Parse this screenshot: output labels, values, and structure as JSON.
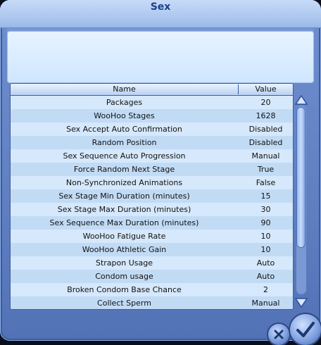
{
  "dialog": {
    "title": "Sex"
  },
  "table": {
    "columns": {
      "name": "Name",
      "value": "Value"
    },
    "rows": [
      {
        "name": "Packages",
        "value": "20"
      },
      {
        "name": "WooHoo Stages",
        "value": "1628"
      },
      {
        "name": "Sex Accept Auto Confirmation",
        "value": "Disabled"
      },
      {
        "name": "Random Position",
        "value": "Disabled"
      },
      {
        "name": "Sex Sequence Auto Progression",
        "value": "Manual"
      },
      {
        "name": "Force Random Next Stage",
        "value": "True"
      },
      {
        "name": "Non-Synchronized Animations",
        "value": "False"
      },
      {
        "name": "Sex Stage Min Duration (minutes)",
        "value": "15"
      },
      {
        "name": "Sex Stage Max Duration (minutes)",
        "value": "30"
      },
      {
        "name": "Sex Sequence Max Duration (minutes)",
        "value": "90"
      },
      {
        "name": "WooHoo Fatigue Rate",
        "value": "10"
      },
      {
        "name": "WooHoo Athletic Gain",
        "value": "10"
      },
      {
        "name": "Strapon Usage",
        "value": "Auto"
      },
      {
        "name": "Condom usage",
        "value": "Auto"
      },
      {
        "name": "Broken Condom Base Chance",
        "value": "2"
      },
      {
        "name": "Collect Sperm",
        "value": "Manual"
      }
    ]
  },
  "icons": {
    "scroll_up": "triangle-up-icon",
    "scroll_down": "triangle-down-icon",
    "cancel": "close-icon",
    "accept": "checkmark-icon"
  },
  "colors": {
    "title": "#1c3f8a",
    "accent": "#5f7fc1"
  }
}
